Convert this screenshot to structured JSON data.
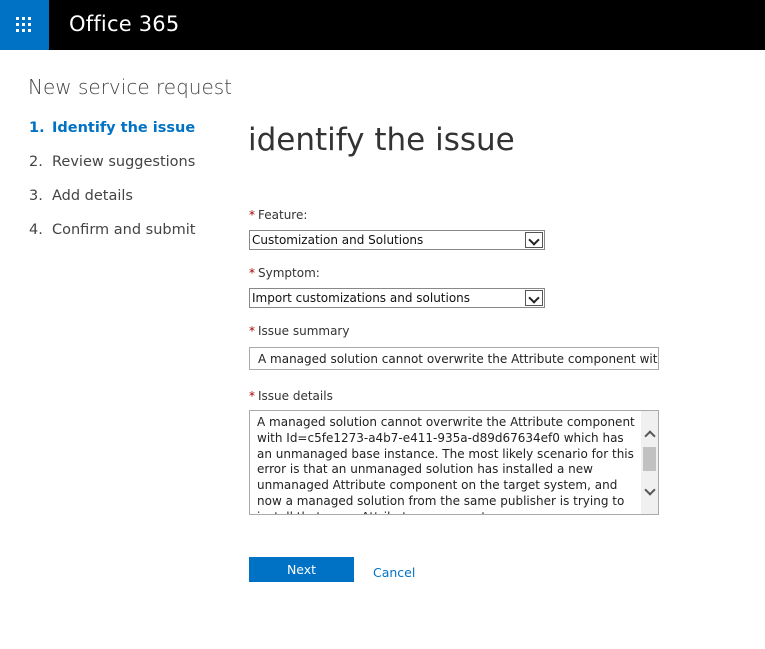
{
  "header": {
    "app_launcher_icon": "waffle-grid-icon",
    "brand": "Office 365",
    "colors": {
      "bar": "#000000",
      "launcher": "#0072c6"
    }
  },
  "page": {
    "title": "New service request"
  },
  "steps": [
    {
      "num": "1.",
      "label": "Identify the issue",
      "active": true
    },
    {
      "num": "2.",
      "label": "Review suggestions",
      "active": false
    },
    {
      "num": "3.",
      "label": "Add details",
      "active": false
    },
    {
      "num": "4.",
      "label": "Confirm and submit",
      "active": false
    }
  ],
  "form": {
    "title": "identify the issue",
    "required_marker": "*",
    "feature": {
      "label": "Feature:",
      "value": "Customization and Solutions"
    },
    "symptom": {
      "label": "Symptom:",
      "value": "Import customizations and solutions"
    },
    "issue_summary": {
      "label": "Issue summary",
      "value": "A managed solution cannot overwrite the Attribute component with Id=[G"
    },
    "issue_details": {
      "label": "Issue details",
      "value": "A managed solution cannot overwrite the Attribute component with Id=c5fe1273-a4b7-e411-935a-d89d67634ef0 which has an unmanaged base instance.  The most likely scenario for this error is that an unmanaged solution has installed a new unmanaged Attribute component on the target system, and now a managed solution from the same publisher is trying to install that same Attribute component"
    }
  },
  "actions": {
    "next": "Next",
    "cancel": "Cancel"
  },
  "colors": {
    "accent": "#0072c6",
    "required": "#a80000"
  }
}
